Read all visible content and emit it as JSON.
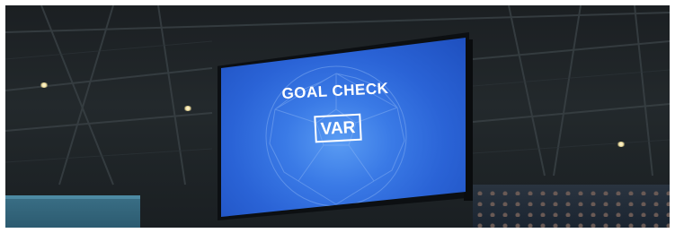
{
  "scene": {
    "description_kind": "stadium-video-board",
    "board": {
      "headline": "GOAL CHECK",
      "badge": "VAR",
      "screen_color": "#2a63d6",
      "text_color": "#ffffff"
    },
    "stand_color": "#3a6f86"
  }
}
